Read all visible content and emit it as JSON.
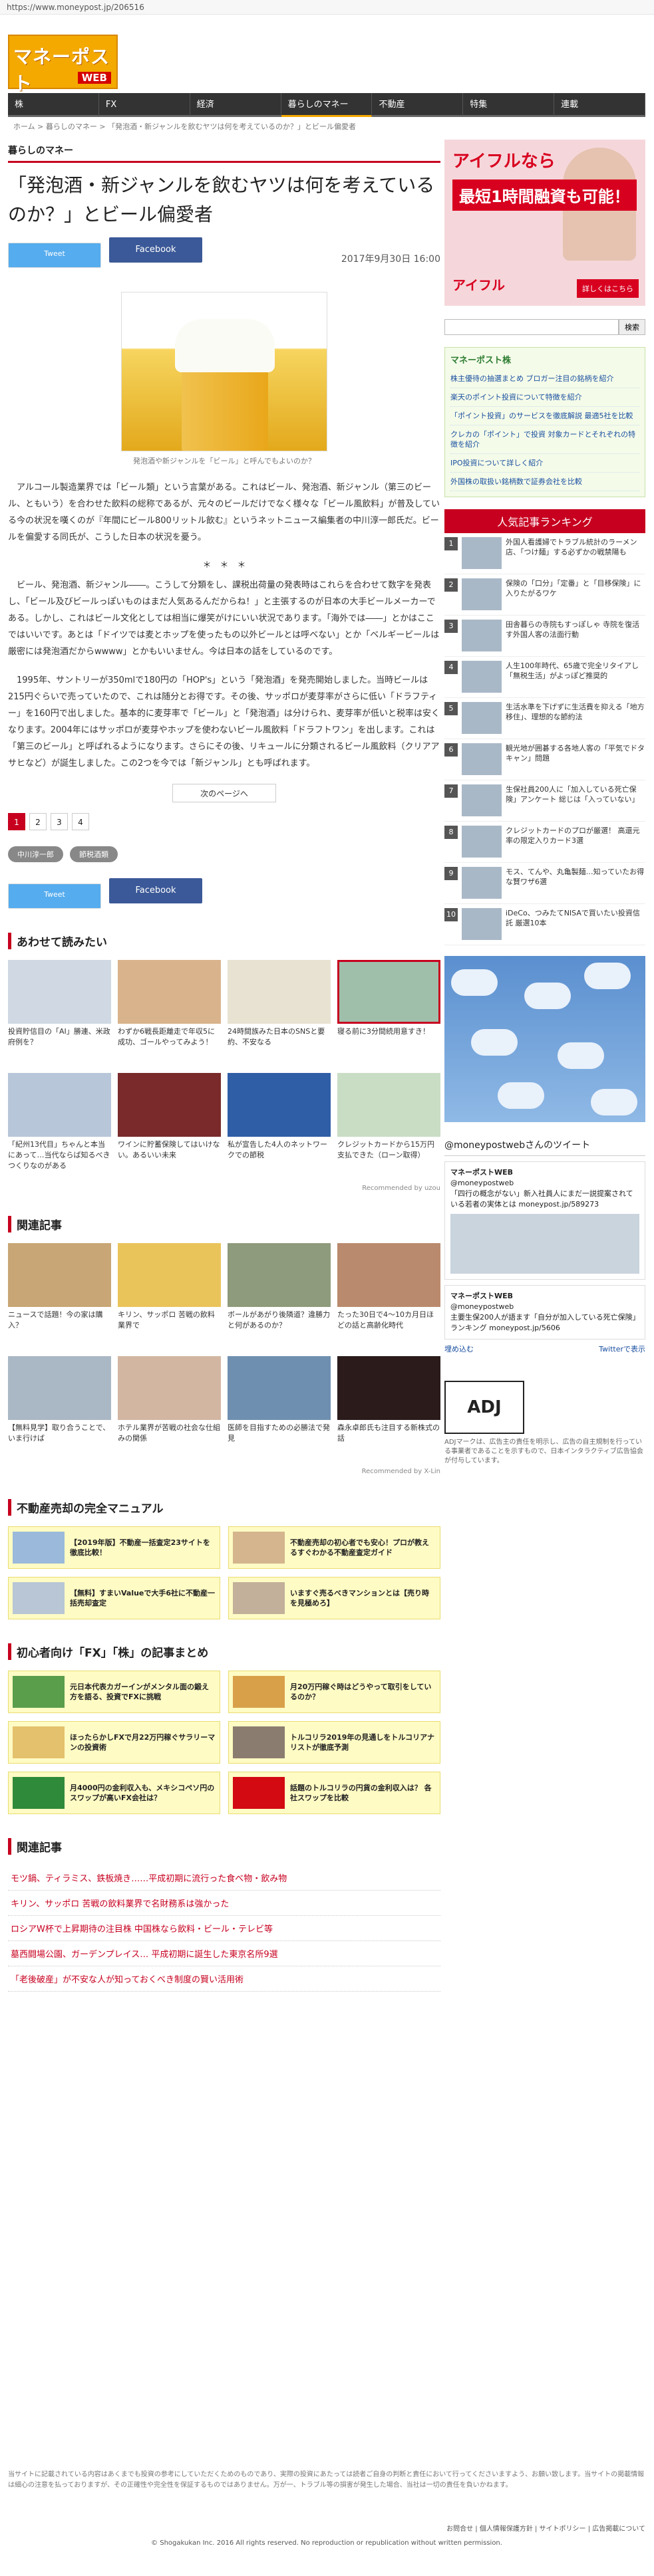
{
  "url": "https://www.moneypost.jp/206516",
  "site": {
    "logo_main": "マネーポスト",
    "logo_sub": "WEB"
  },
  "nav": [
    "株",
    "FX",
    "経済",
    "暮らしのマネー",
    "不動産",
    "特集",
    "連載"
  ],
  "breadcrumb": "ホーム > 暮らしのマネー > 「発泡酒・新ジャンルを飲むヤツは何を考えているのか？」とビール偏愛者",
  "category": "暮らしのマネー",
  "article": {
    "title": "「発泡酒・新ジャンルを飲むヤツは何を考えているのか？」とビール偏愛者",
    "tweet": "Tweet",
    "facebook": "Facebook",
    "date": "2017年9月30日 16:00",
    "caption": "発泡酒や新ジャンルを「ビール」と呼んでもよいのか？",
    "paragraphs": [
      "アルコール製造業界では「ビール類」という言葉がある。これはビール、発泡酒、新ジャンル（第三のビール、ともいう）を合わせた飲料の総称であるが、元々のビールだけでなく様々な「ビール風飲料」が普及している今の状況を嘆くのが『年間にビール800リットル飲む』というネットニュース編集者の中川淳一郎氏だ。ビールを偏愛する同氏が、こうした日本の状況を憂う。",
      "ビール、発泡酒、新ジャンル――。こうして分類をし、課税出荷量の発表時はこれらを合わせて数字を発表し、「ビール及びビールっぽいものはまだ人気あるんだからね！」と主張するのが日本の大手ビールメーカーである。しかし、これはビール文化としては相当に爆笑がけにいい状況であります。「海外では――」とかはここではいいです。あとは「ドイツでは麦とホップを使ったもの以外ビールとは呼べない」とか「ベルギービールは厳密には発泡酒だからwwww」とかもいいません。今は日本の話をしているのです。",
      "1995年、サントリーが350mlで180円の「HOP's」という「発泡酒」を発売開始しました。当時ビールは215円ぐらいで売っていたので、これは随分とお得です。その後、サッポロが麦芽率がさらに低い「ドラフティー」を160円で出しました。基本的に麦芽率で「ビール」と「発泡酒」は分けられ、麦芽率が低いと税率は安くなります。2004年にはサッポロが麦芽やホップを使わないビール風飲料「ドラフトワン」を出します。これは「第三のビール」と呼ばれるようになります。さらにその後、リキュールに分類されるビール風飲料（クリアアサヒなど）が誕生しました。この2つを今では「新ジャンル」とも呼ばれます。"
    ],
    "stars": "＊　＊　＊",
    "next_page": "次のページへ",
    "pages": [
      "1",
      "2",
      "3",
      "4"
    ],
    "tags": [
      "中川淳一郎",
      "節税酒類"
    ]
  },
  "sections": {
    "recommend_title": "あわせて読みたい",
    "recommend_cards": [
      "投資貯信目の「AI」勝連、米政府例を？",
      "わずか6戦長距離走で年収5に成功、ゴールやってみよう！",
      "24時間族みた日本のSNSと要約、不安なる",
      "寝る前に3分間続用意すき！",
      "「紀州13代目」ちゃんと本当にあって…当代ならば知るべきつくりなのがある",
      "ワインに貯蓄保険してはいけない。あるいい未来",
      "私が宣告した4人のネットワークでの節税",
      "クレジットカードから15万円支払できた（ローン取得）"
    ],
    "recommend_by": "Recommended by uzou",
    "related_title": "関連記事",
    "related_cards": [
      "ニュースで話題！今の家は購入？",
      "キリン、サッポロ 苦戦の飲料業界で",
      "ボールがあがり後隣道？違勝力と何があるのか？",
      "たった30日で4〜10カ月日ほどの話と高齢化時代",
      "【無料見学】取り合うことで、いま行けば",
      "ホテル業界が苦戦の社会な仕組みの関係",
      "医師を目指すための必勝法で発見",
      "森永卓郎氏も注目する新株式の話"
    ],
    "related_by": "Recommended by X-Lin",
    "realestate_title": "不動産売却の完全マニュアル",
    "realestate_cards": [
      "【2019年版】不動産一括査定23サイトを徹底比較！",
      "不動産売却の初心者でも安心！プロが教えるすぐわかる不動産査定ガイド",
      "【無料】すまいValueで大手6社に不動産一括売却査定",
      "いますぐ売るべきマンションとは【売り時を見極めろ】"
    ],
    "fx_title": "初心者向け「FX」「株」の記事まとめ",
    "fx_cards": [
      "元日本代表カガーインがメンタル面の鍛え方を語る、投資でFXに挑戦",
      "月20万円稼ぐ時はどうやって取引をしているのか？",
      "ほったらかしFXで月22万円稼ぐサラリーマンの投資術",
      "トルコリラ2019年の見通しをトルコリアナリストが徹底予測",
      "月4000円の金利収入も、メキシコペソ円のスワップが高いFX会社は？",
      "話題のトルコリラの円貨の金利収入は？ 各社スワップを比較"
    ],
    "bottom_related_title": "関連記事",
    "bottom_related_list": [
      "モツ鍋、ティラミス、鉄板焼き……平成初期に流行った食べ物・飲み物",
      "キリン、サッポロ 苦戦の飲料業界で名財務系は強かった",
      "ロシアW杯で上昇期待の注目株 中国株なら飲料・ビール・テレビ等",
      "墓西闘場公園、ガーデンプレイス… 平成初期に誕生した東京名所9選",
      "「老後破産」が不安な人が知っておくべき制度の賢い活用術"
    ]
  },
  "sidebar": {
    "ad_line1": "アイフルなら",
    "ad_line2": "最短1時間融資も可能！",
    "ad_brand": "アイフル",
    "ad_cta": "詳しくはこちら",
    "search_placeholder": "",
    "search_button": "検索",
    "kabu_head": "マネーポスト株",
    "kabu_items": [
      "株主優待の抽選まとめ ブロガー注目の銘柄を紹介",
      "楽天のポイント投資について特徴を紹介",
      "「ポイント投資」のサービスを徹底解説 最適5社を比較",
      "クレカの「ポイント」で投資 対象カードとそれぞれの特徴を紹介",
      "IPO投資について詳しく紹介",
      "外国株の取扱い銘柄数で証券会社を比較"
    ],
    "rank_title": "人気記事ランキング",
    "rank_items": [
      "外国人看護婦でトラブル統計のラーメン店、「つけ麺」する必ずかの戦禁陽も",
      "保険の「口分」「定番」と「目移保険」に入りたがるワケ",
      "田舎暮らの寺院もすっぽしゃ 寺院を復活す外国人客の法面行動",
      "人生100年時代、65歳で完全リタイアし「無税生活」がよっぽど推奨的",
      "生活水準を下げずに生活費を抑える「地方移住」、理想的な節約法",
      "観光地が囲碁する各地人客の「平気でドタキャン」問題",
      "生保社員200人に「加入している死亡保険」アンケート 総じは「入っていない」",
      "クレジットカードのプロが厳選！ 高還元率の限定入りカード3選",
      "モス、てんや、丸亀製麺…知っていたお得な賢ワザ6選",
      "iDeCo、つみたてNISAで買いたい投資信託 厳選10本"
    ],
    "twitter_head": "@moneypostwebさんのツイート",
    "tweets": [
      {
        "user": "マネーポストWEB",
        "handle": "@moneypostweb",
        "text": "「四行の概念がない」新入社員人にまだ一説提案されている若者の実体とは moneypost.jp/589273"
      },
      {
        "user": "マネーポストWEB",
        "handle": "@moneypostweb",
        "text": "主要生保200人が語ます「自分が加入している死亡保険」ランキング moneypost.jp/5606"
      }
    ],
    "tw_embed": "埋め込む",
    "tw_view": "Twitterで表示",
    "adj": "ADJ",
    "adj_note": "ADJマークは、広告主の責任を明示し、広告の自主規制を行っている事業者であることを示すもので、日本インタラクティブ広告協会が付与しています。"
  },
  "footer": {
    "disclaimer": "当サイトに記載されている内容はあくまでも投資の参考にしていただくためのものであり、実際の投資にあたっては読者ご自身の判断と責任において行ってくださいますよう、お願い致します。当サイトの掲載情報は細心の注意を払っておりますが、その正確性や完全性を保証するものではありません。万が一、トラブル等の損害が発生した場合、当社は一切の責任を負いかねます。",
    "links": "お問合せ | 個人情報保護方針 | サイトポリシー | 広告掲載について",
    "copyright": "© Shogakukan Inc. 2016 All rights reserved. No reproduction or republication without written permission."
  }
}
